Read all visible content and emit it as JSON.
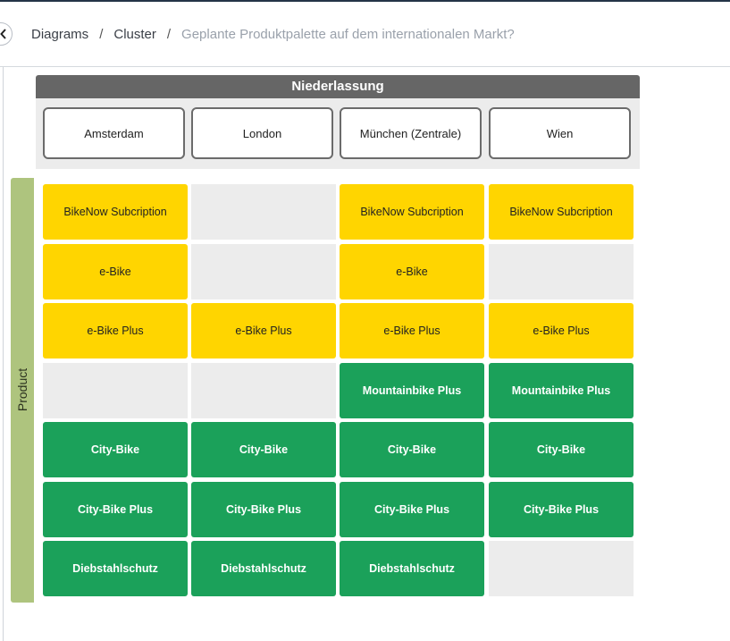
{
  "breadcrumb": {
    "items": [
      "Diagrams",
      "Cluster"
    ],
    "current": "Geplante Produktpalette auf dem internationalen Markt?",
    "separator": "/"
  },
  "matrix": {
    "column_axis_label": "Niederlassung",
    "row_axis_label": "Product",
    "columns": [
      "Amsterdam",
      "London",
      "München (Zentrale)",
      "Wien"
    ],
    "rows": [
      [
        "BikeNow Subcription",
        "",
        "BikeNow Subcription",
        "BikeNow Subcription"
      ],
      [
        "e-Bike",
        "",
        "e-Bike",
        ""
      ],
      [
        "e-Bike Plus",
        "e-Bike Plus",
        "e-Bike Plus",
        "e-Bike Plus"
      ],
      [
        "",
        "",
        "Mountainbike Plus",
        "Mountainbike Plus"
      ],
      [
        "City-Bike",
        "City-Bike",
        "City-Bike",
        "City-Bike"
      ],
      [
        "City-Bike Plus",
        "City-Bike Plus",
        "City-Bike Plus",
        "City-Bike Plus"
      ],
      [
        "Diebstahlschutz",
        "Diebstahlschutz",
        "Diebstahlschutz",
        ""
      ]
    ],
    "row_colors": [
      "yellow",
      "yellow",
      "yellow",
      "green",
      "green",
      "green",
      "green"
    ],
    "colors": {
      "yellow": "#ffd500",
      "green": "#1ba15a",
      "empty": "#ececec",
      "header": "#666666",
      "row_axis": "#aec47e"
    }
  },
  "icons": {
    "back": "chevron-left-icon"
  }
}
